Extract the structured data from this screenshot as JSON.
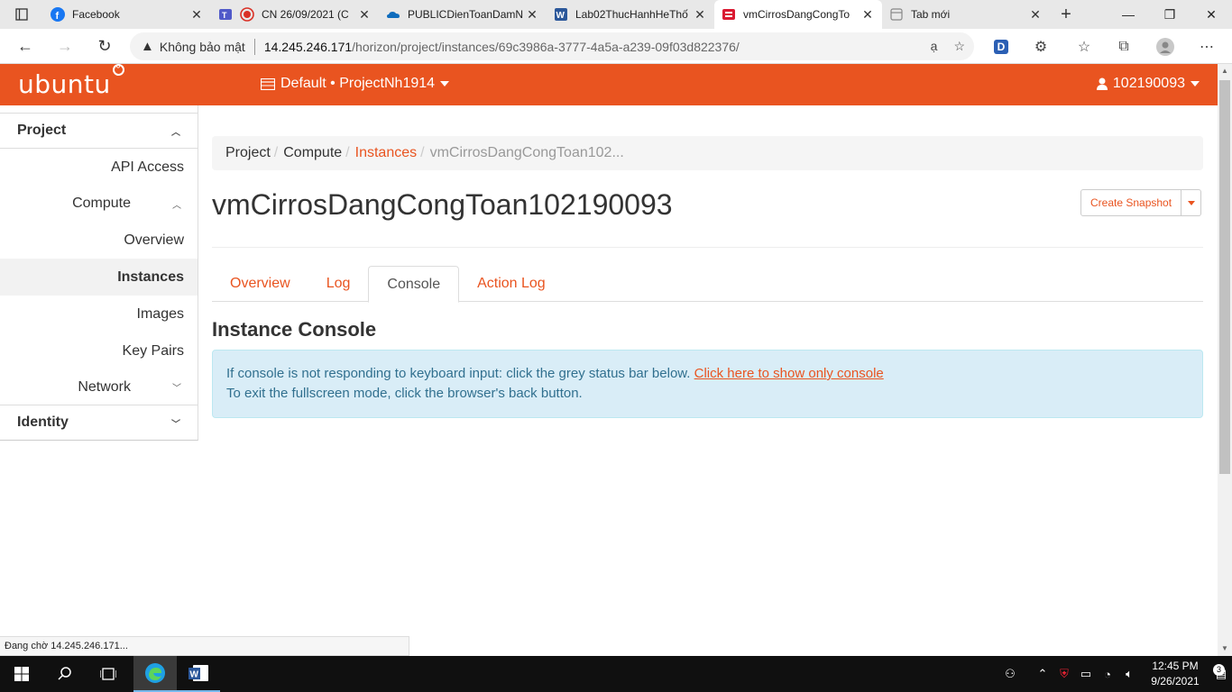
{
  "browser": {
    "tabs": [
      {
        "title": "Facebook",
        "icon": "facebook-icon",
        "color": "#1877f2"
      },
      {
        "title": "CN 26/09/2021 (C",
        "icon": "teams-recording-icon",
        "color": "#d93025"
      },
      {
        "title": "PUBLICDienToanDamN",
        "icon": "onedrive-icon",
        "color": "#0f6cbd"
      },
      {
        "title": "Lab02ThucHanhHeThố",
        "icon": "word-icon",
        "color": "#2b579a"
      },
      {
        "title": "vmCirrosDangCongTo",
        "icon": "openstack-icon",
        "color": "#da1a32"
      },
      {
        "title": "Tab mới",
        "icon": "newtab-page-icon",
        "color": "#888888"
      }
    ],
    "active_tab_index": 4,
    "security_label": "Không bảo mật",
    "url_host": "14.245.246.171",
    "url_path": "/horizon/project/instances/69c3986a-3777-4a5a-a239-09f03d822376/",
    "extension_letter": "D",
    "status_text": "Đang chờ 14.245.246.171..."
  },
  "header": {
    "logo": "ubuntu",
    "project_selector": "Default • ProjectNh1914",
    "user": "102190093",
    "accent_color": "#e95420"
  },
  "sidebar": {
    "project": "Project",
    "api_access": "API Access",
    "compute": "Compute",
    "overview": "Overview",
    "instances": "Instances",
    "images": "Images",
    "key_pairs": "Key Pairs",
    "network": "Network",
    "identity": "Identity"
  },
  "breadcrumb": {
    "project": "Project",
    "compute": "Compute",
    "instances": "Instances",
    "current": "vmCirrosDangCongToan102..."
  },
  "page": {
    "title": "vmCirrosDangCongToan102190093",
    "create_snapshot": "Create Snapshot",
    "tabs": [
      "Overview",
      "Log",
      "Console",
      "Action Log"
    ],
    "active_tab": "Console",
    "section_title": "Instance Console",
    "alert_line1": "If console is not responding to keyboard input: click the grey status bar below.",
    "alert_link": "Click here to show only console",
    "alert_line2": "To exit the fullscreen mode, click the browser's back button."
  },
  "taskbar": {
    "time": "12:45 PM",
    "date": "9/26/2021",
    "notification_count": "3"
  }
}
